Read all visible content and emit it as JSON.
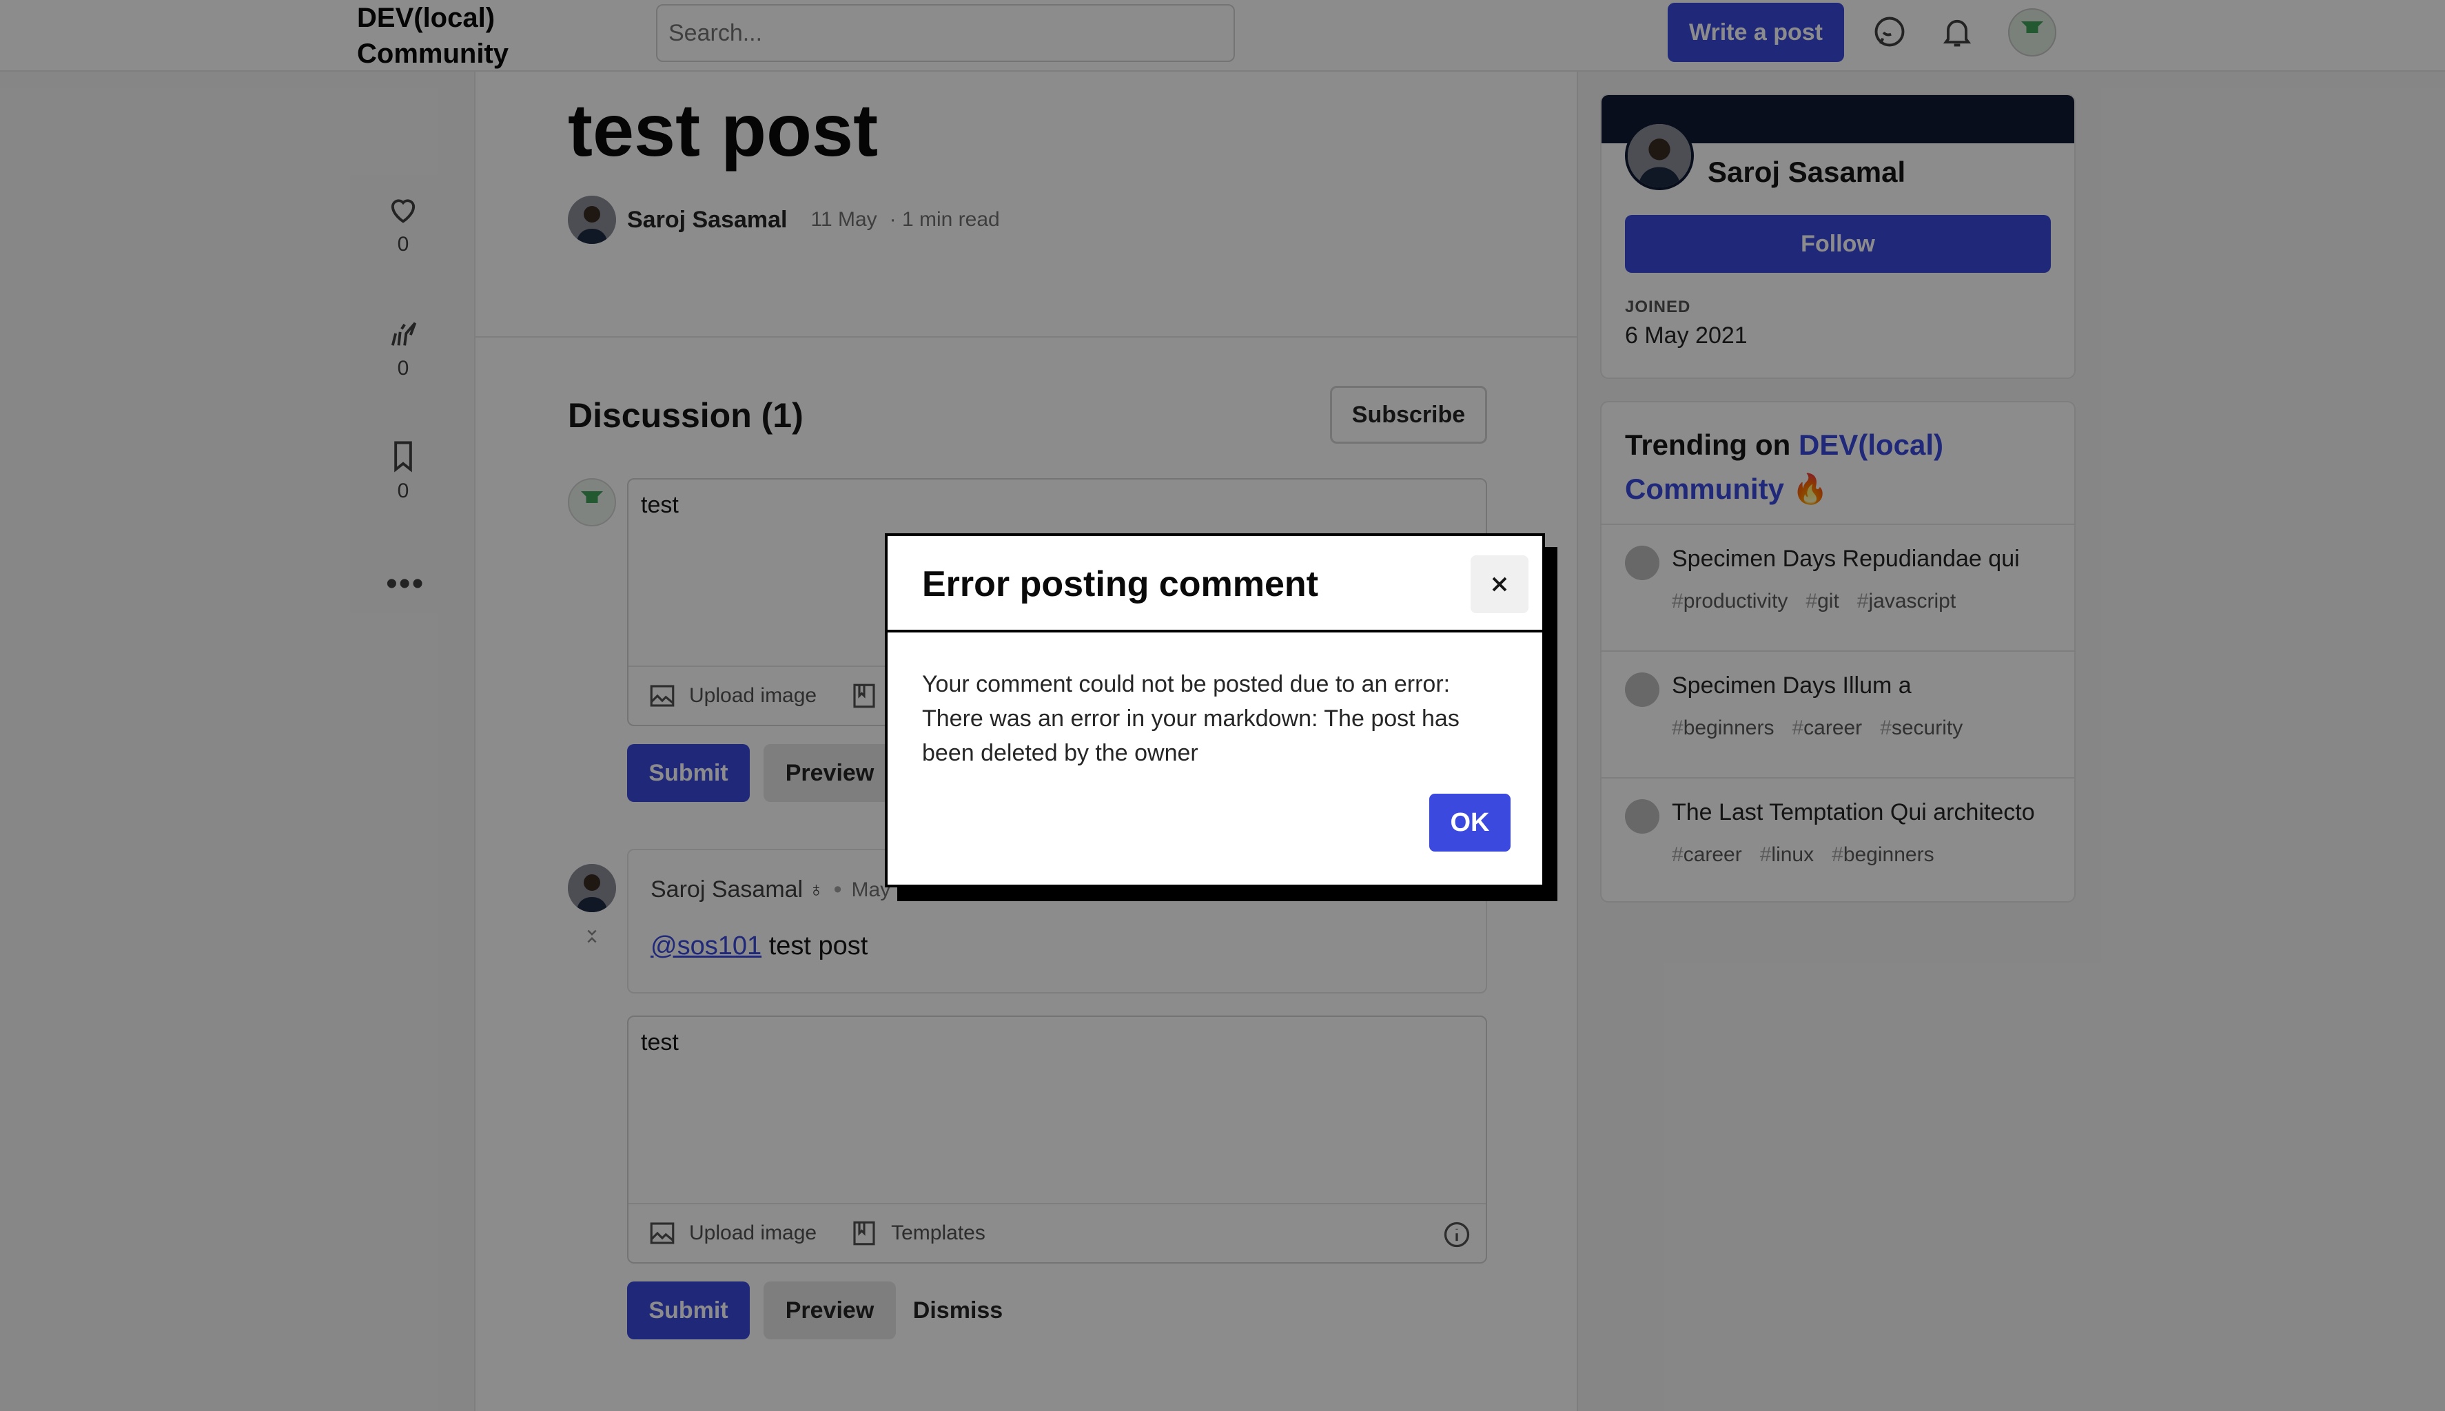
{
  "header": {
    "logo_line1": "DEV(local)",
    "logo_line2": "Community",
    "search_placeholder": "Search...",
    "write_post_label": "Write a post"
  },
  "reactions": [
    {
      "icon": "heart-icon",
      "count": "0"
    },
    {
      "icon": "unicorn-icon",
      "count": "0"
    },
    {
      "icon": "bookmark-icon",
      "count": "0"
    }
  ],
  "more_label": "•••",
  "post": {
    "title": "test post",
    "author": "Saroj Sasamal",
    "date": "11 May",
    "read_time": "· 1 min read"
  },
  "discussion": {
    "title": "Discussion (1)",
    "subscribe_label": "Subscribe",
    "composer": {
      "text": "test",
      "upload_label": "Upload image",
      "submit_label": "Submit",
      "preview_label": "Preview"
    },
    "comment": {
      "author": "Saroj Sasamal",
      "badge": "♁",
      "dot": "•",
      "date": "May",
      "mention": "@sos101",
      "body": "test post"
    },
    "reply": {
      "text": "test",
      "upload_label": "Upload image",
      "templates_label": "Templates",
      "submit_label": "Submit",
      "preview_label": "Preview",
      "dismiss_label": "Dismiss"
    }
  },
  "profile": {
    "name": "Saroj Sasamal",
    "follow_label": "Follow",
    "joined_label": "JOINED",
    "joined_value": "6 May 2021"
  },
  "trending": {
    "heading_prefix": "Trending on ",
    "brand_line1": "DEV(local)",
    "brand_line2": "Community",
    "fire": "🔥",
    "items": [
      {
        "title": "Specimen Days Repudiandae qui",
        "tags": [
          "productivity",
          "git",
          "javascript"
        ]
      },
      {
        "title": "Specimen Days Illum a",
        "tags": [
          "beginners",
          "career",
          "security"
        ]
      },
      {
        "title": "The Last Temptation Qui architecto",
        "tags": [
          "career",
          "linux",
          "beginners"
        ]
      }
    ]
  },
  "modal": {
    "title": "Error posting comment",
    "close_glyph": "✕",
    "body": "Your comment could not be posted due to an error: There was an error in your markdown: The post has been deleted by the owner",
    "ok_label": "OK"
  },
  "colors": {
    "accent": "#3b49df",
    "banner": "#0f1a33"
  }
}
